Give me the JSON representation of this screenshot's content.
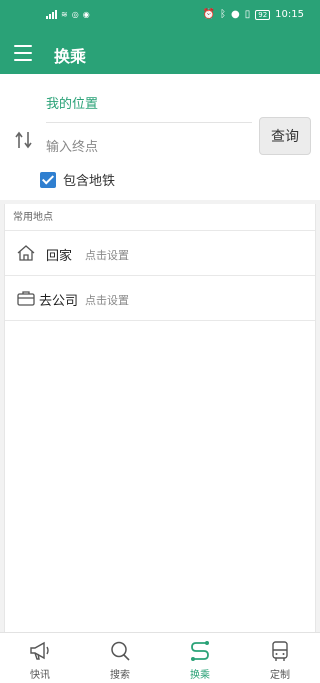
{
  "status_bar": {
    "time": "10:15",
    "battery": "92"
  },
  "app_bar": {
    "title": "换乘"
  },
  "route": {
    "from_label": "我的位置",
    "to_placeholder": "输入终点",
    "query_label": "查询",
    "include_subway_label": "包含地铁",
    "include_subway_checked": true
  },
  "places": {
    "section_title": "常用地点",
    "items": [
      {
        "name": "回家",
        "hint": "点击设置",
        "icon": "home-icon"
      },
      {
        "name": "去公司",
        "hint": "点击设置",
        "icon": "briefcase-icon"
      }
    ]
  },
  "tabs": [
    {
      "label": "快讯",
      "icon": "megaphone-icon",
      "active": false
    },
    {
      "label": "搜索",
      "icon": "search-icon",
      "active": false
    },
    {
      "label": "换乘",
      "icon": "route-icon",
      "active": true
    },
    {
      "label": "定制",
      "icon": "bus-icon",
      "active": false
    }
  ],
  "colors": {
    "primary": "#2aa277",
    "checkbox": "#2f7fd0"
  }
}
